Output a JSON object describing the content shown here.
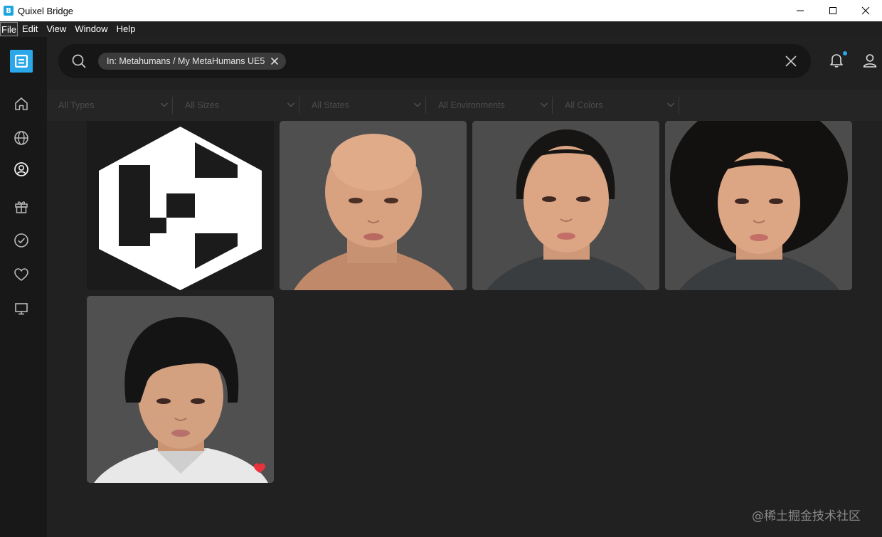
{
  "window": {
    "title": "Quixel Bridge",
    "app_icon_letter": "B",
    "controls": [
      "—",
      "☐",
      "✕"
    ]
  },
  "menubar": {
    "items": [
      "File",
      "Edit",
      "View",
      "Window",
      "Help"
    ]
  },
  "sidebar": {
    "logo": "bridge-logo",
    "items": [
      {
        "icon": "home-icon"
      },
      {
        "icon": "globe-icon"
      },
      {
        "icon": "user-circle-icon"
      },
      {
        "icon": "gift-icon"
      },
      {
        "icon": "check-circle-icon"
      },
      {
        "icon": "heart-icon"
      },
      {
        "icon": "monitor-icon"
      }
    ]
  },
  "search": {
    "chip_label": "In: Metahumans / My MetaHumans UE5",
    "value": "",
    "placeholder": ""
  },
  "filters": [
    {
      "label": "All Types"
    },
    {
      "label": "All Sizes"
    },
    {
      "label": "All States"
    },
    {
      "label": "All Environments"
    },
    {
      "label": "All Colors"
    }
  ],
  "assets": [
    {
      "kind": "logo",
      "favorite": false
    },
    {
      "kind": "face",
      "hair": "bald",
      "favorite": false
    },
    {
      "kind": "face",
      "hair": "receding",
      "favorite": false
    },
    {
      "kind": "face",
      "hair": "afro",
      "favorite": false
    },
    {
      "kind": "face",
      "hair": "short-bangs",
      "favorite": true
    }
  ],
  "colors": {
    "accent": "#2aa8ea",
    "favorite": "#e8323c",
    "background": "#212121"
  },
  "watermark": "@稀土掘金技术社区"
}
